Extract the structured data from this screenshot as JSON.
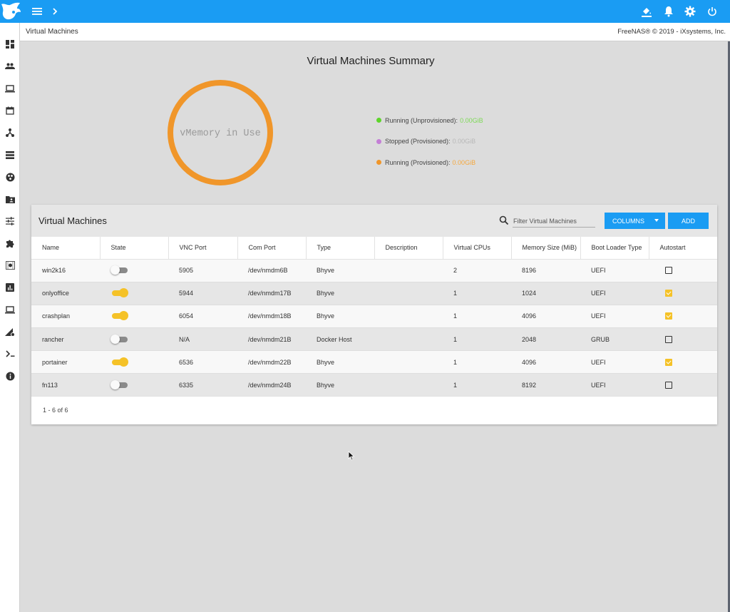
{
  "header": {
    "icons": [
      "menu-icon",
      "chevron-right-icon",
      "theme-icon",
      "bell-icon",
      "gear-icon",
      "power-icon"
    ]
  },
  "sidebar": {
    "items": [
      {
        "name": "dashboard",
        "icon": "dashboard-icon"
      },
      {
        "name": "accounts",
        "icon": "people-icon"
      },
      {
        "name": "system",
        "icon": "laptop-icon"
      },
      {
        "name": "tasks",
        "icon": "calendar-icon"
      },
      {
        "name": "network",
        "icon": "network-icon"
      },
      {
        "name": "storage",
        "icon": "storage-icon"
      },
      {
        "name": "directory-services",
        "icon": "directory-icon"
      },
      {
        "name": "sharing",
        "icon": "folder-shared-icon"
      },
      {
        "name": "services",
        "icon": "tune-icon"
      },
      {
        "name": "plugins",
        "icon": "puzzle-icon"
      },
      {
        "name": "jails",
        "icon": "jail-icon"
      },
      {
        "name": "reporting",
        "icon": "chart-icon"
      },
      {
        "name": "virtual-machines",
        "icon": "computer-icon"
      },
      {
        "name": "display-system-processes",
        "icon": "processes-icon"
      },
      {
        "name": "shell",
        "icon": "terminal-icon"
      },
      {
        "name": "guide",
        "icon": "info-icon"
      }
    ]
  },
  "breadcrumb": {
    "current": "Virtual Machines",
    "copyright": "FreeNAS® © 2019 - iXsystems, Inc."
  },
  "summary": {
    "title": "Virtual Machines Summary",
    "donut_label": "vMemory in Use",
    "donut_color": "#f0962a",
    "legend": [
      {
        "label": "Running (Unprovisioned):",
        "value": "0.00GiB",
        "color": "#5ed52b",
        "value_color": "#7ed957"
      },
      {
        "label": "Stopped (Provisioned):",
        "value": "0.00GiB",
        "color": "#c47fd6",
        "value_color": "#b8b8b8"
      },
      {
        "label": "Running (Provisioned):",
        "value": "0.00GiB",
        "color": "#f0962a",
        "value_color": "#f5a83e"
      }
    ]
  },
  "vm_table": {
    "title": "Virtual Machines",
    "filter_placeholder": "Filter Virtual Machines",
    "columns_button": "COLUMNS",
    "add_button": "ADD",
    "headers": [
      "Name",
      "State",
      "VNC Port",
      "Com Port",
      "Type",
      "Description",
      "Virtual CPUs",
      "Memory Size (MiB)",
      "Boot Loader Type",
      "Autostart"
    ],
    "rows": [
      {
        "name": "win2k16",
        "state_on": false,
        "vnc_port": "5905",
        "com_port": "/dev/nmdm6B",
        "type": "Bhyve",
        "description": "",
        "vcpus": "2",
        "memory": "8196",
        "bootloader": "UEFI",
        "autostart": false
      },
      {
        "name": "onlyoffice",
        "state_on": true,
        "vnc_port": "5944",
        "com_port": "/dev/nmdm17B",
        "type": "Bhyve",
        "description": "",
        "vcpus": "1",
        "memory": "1024",
        "bootloader": "UEFI",
        "autostart": true
      },
      {
        "name": "crashplan",
        "state_on": true,
        "vnc_port": "6054",
        "com_port": "/dev/nmdm18B",
        "type": "Bhyve",
        "description": "",
        "vcpus": "1",
        "memory": "4096",
        "bootloader": "UEFI",
        "autostart": true
      },
      {
        "name": "rancher",
        "state_on": false,
        "vnc_port": "N/A",
        "com_port": "/dev/nmdm21B",
        "type": "Docker Host",
        "description": "",
        "vcpus": "1",
        "memory": "2048",
        "bootloader": "GRUB",
        "autostart": false
      },
      {
        "name": "portainer",
        "state_on": true,
        "vnc_port": "6536",
        "com_port": "/dev/nmdm22B",
        "type": "Bhyve",
        "description": "",
        "vcpus": "1",
        "memory": "4096",
        "bootloader": "UEFI",
        "autostart": true
      },
      {
        "name": "fn113",
        "state_on": false,
        "vnc_port": "6335",
        "com_port": "/dev/nmdm24B",
        "type": "Bhyve",
        "description": "",
        "vcpus": "1",
        "memory": "8192",
        "bootloader": "UEFI",
        "autostart": false
      }
    ],
    "pagination": "1 - 6 of 6"
  }
}
